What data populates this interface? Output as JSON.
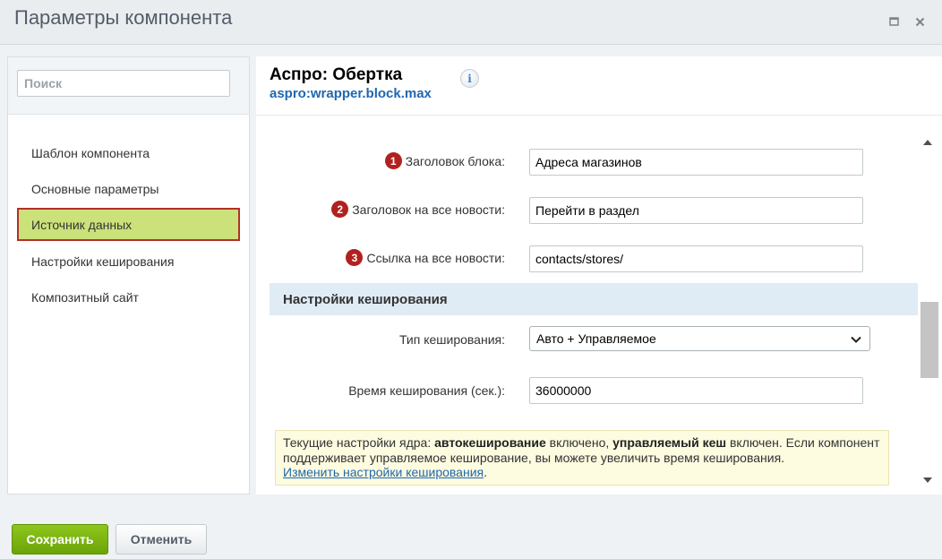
{
  "window": {
    "title": "Параметры компонента"
  },
  "sidebar": {
    "search_placeholder": "Поиск",
    "items": [
      {
        "label": "Шаблон компонента"
      },
      {
        "label": "Основные параметры"
      },
      {
        "label": "Источник данных",
        "active": true
      },
      {
        "label": "Настройки кеширования"
      },
      {
        "label": "Композитный сайт"
      }
    ]
  },
  "component": {
    "title": "Аспро: Обертка",
    "code": "aspro:wrapper.block.max",
    "info_glyph": "i"
  },
  "fields": [
    {
      "badge": "1",
      "label": "Заголовок блока:",
      "value": "Адреса магазинов"
    },
    {
      "badge": "2",
      "label": "Заголовок на все новости:",
      "value": "Перейти в раздел"
    },
    {
      "badge": "3",
      "label": "Ссылка на все новости:",
      "value": "contacts/stores/"
    }
  ],
  "cache_section": {
    "header": "Настройки кеширования",
    "type_label": "Тип кеширования:",
    "type_value": "Авто + Управляемое",
    "time_label": "Время кеширования (сек.):",
    "time_value": "36000000"
  },
  "notice": {
    "part1": "Текущие настройки ядра: ",
    "bold1": "автокеширование",
    "part2": " включено, ",
    "bold2": "управляемый кеш",
    "part3": " включен. Если компонент поддерживает управляемое кеширование, вы можете увеличить время кеширования.",
    "link": "Изменить настройки кеширования",
    "part4": "."
  },
  "footer": {
    "save_label": "Сохранить",
    "cancel_label": "Отменить"
  },
  "colors": {
    "active_item_bg": "#cbe17a",
    "active_item_border": "#b3302a",
    "badge": "#b1211f",
    "link": "#2067b0",
    "save_button": "#7ab513"
  }
}
